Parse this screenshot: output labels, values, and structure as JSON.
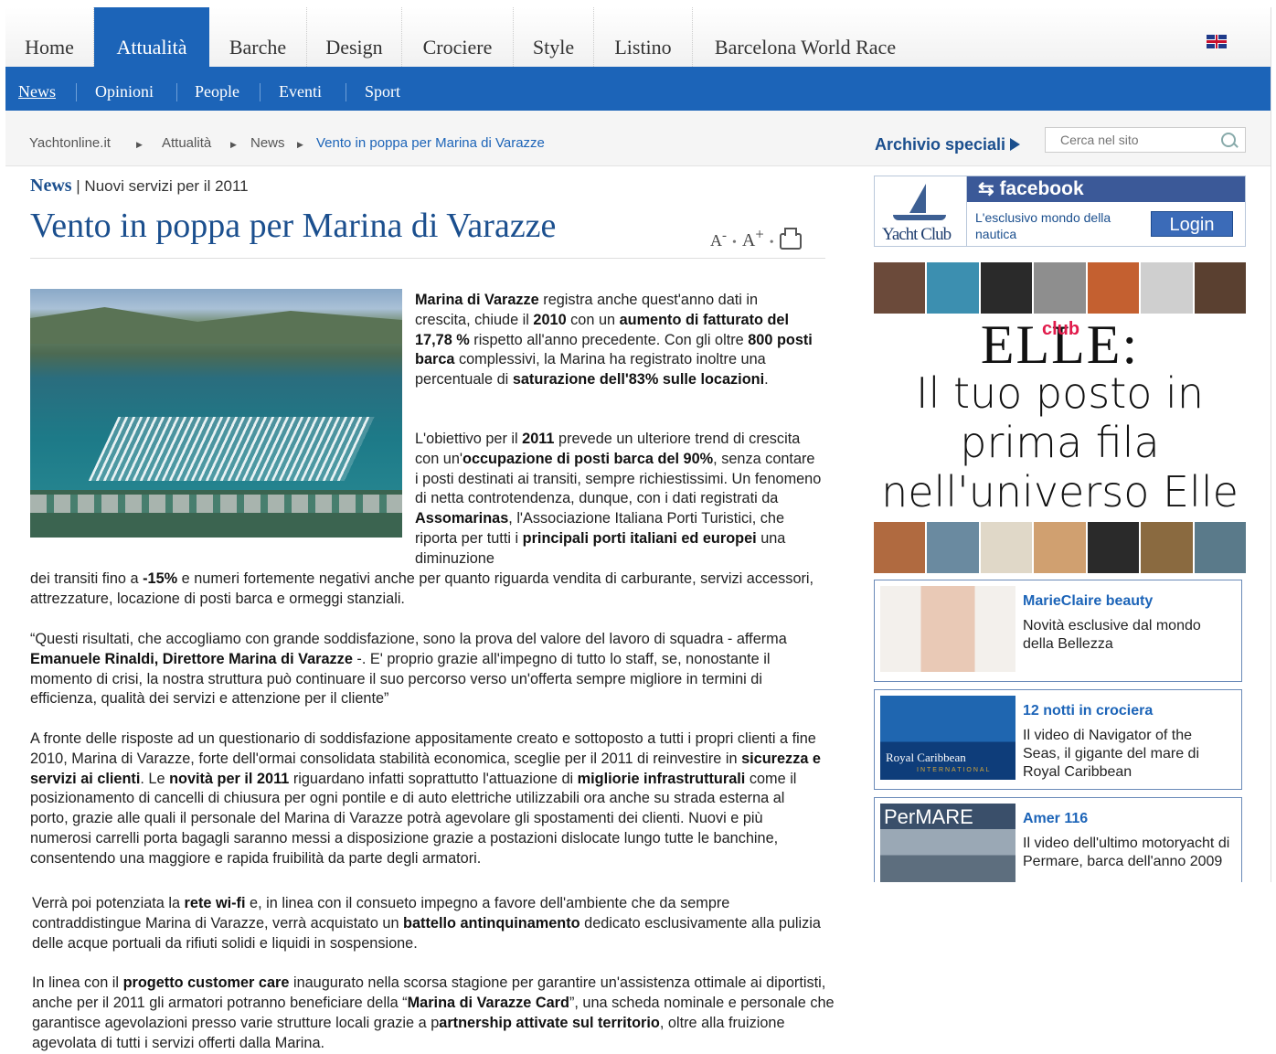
{
  "nav": {
    "main": [
      "Home",
      "Attualità",
      "Barche",
      "Design",
      "Crociere",
      "Style",
      "Listino",
      "Barcelona World Race"
    ],
    "active": "Attualità",
    "sub": [
      "News",
      "Opinioni",
      "People",
      "Eventi",
      "Sport"
    ],
    "sub_active": "News",
    "language_icon": "uk-flag-icon"
  },
  "breadcrumb": {
    "items": [
      "Yachtonline.it",
      "Attualità",
      "News",
      "Vento in poppa per Marina di Varazze"
    ]
  },
  "archive_label": "Archivio speciali",
  "search": {
    "placeholder": "Cerca nel sito"
  },
  "article": {
    "section": "News",
    "subtitle": "Nuovi servizi per il 2011",
    "title": "Vento in poppa per Marina di Varazze",
    "tools": {
      "smaller": "A",
      "smaller_sup": "-",
      "larger": "A",
      "larger_sup": "+",
      "print_icon": "printer-icon"
    }
  },
  "sidebar": {
    "facebook": {
      "logo_text": "Yacht Club",
      "brand": "facebook",
      "text": "L'esclusivo mondo della nautica",
      "login": "Login"
    },
    "ad": {
      "brand": "ELLE",
      "club": "club",
      "brand_suffix": ":",
      "slogan_lines": [
        "Il tuo posto in",
        "prima fila",
        "nell'universo Elle"
      ]
    },
    "promos": [
      {
        "title": "MarieClaire beauty",
        "desc": "Novità esclusive dal mondo della Bellezza"
      },
      {
        "title": "12 notti in crociera",
        "desc": "Il video di Navigator of the Seas, il gigante del mare di Royal Caribbean",
        "logo_text": "Royal Caribbean",
        "logo_sub": "INTERNATIONAL"
      },
      {
        "title": "Amer 116",
        "desc": "Il video dell'ultimo motoryacht di Permare, barca dell'anno 2009",
        "logo_text": "PerMARE"
      }
    ]
  },
  "colors": {
    "nav_blue": "#1c64b8",
    "title_blue": "#1b4f8e",
    "facebook_blue": "#3b5998"
  }
}
